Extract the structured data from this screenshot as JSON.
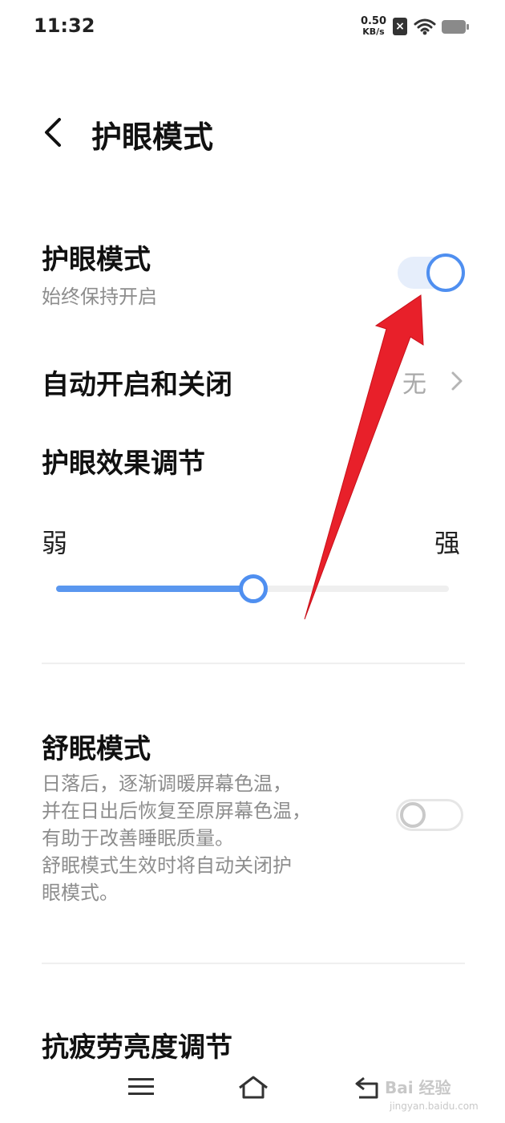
{
  "status_bar": {
    "time": "11:32",
    "net_speed": "0.50",
    "net_unit": "KB/s",
    "sim_mark": "×"
  },
  "header": {
    "title": "护眼模式"
  },
  "eye_mode": {
    "title": "护眼模式",
    "subtitle": "始终保持开启",
    "enabled": true
  },
  "auto_schedule": {
    "title": "自动开启和关闭",
    "value": "无"
  },
  "effect": {
    "title": "护眼效果调节",
    "min_label": "弱",
    "max_label": "强",
    "level_fraction": 0.5
  },
  "sleep_mode": {
    "title": "舒眠模式",
    "description_lines": [
      "日落后，逐渐调暖屏幕色温，",
      "并在日出后恢复至原屏幕色温，",
      "有助于改善睡眠质量。",
      "舒眠模式生效时将自动关闭护",
      "眼模式。"
    ],
    "enabled": false
  },
  "anti_fatigue": {
    "title": "抗疲劳亮度调节"
  },
  "watermark": {
    "brand": "Bai 经验",
    "url": "jingyan.baidu.com"
  },
  "colors": {
    "accent": "#4f8ff0",
    "annotation_arrow": "#e8202a"
  }
}
